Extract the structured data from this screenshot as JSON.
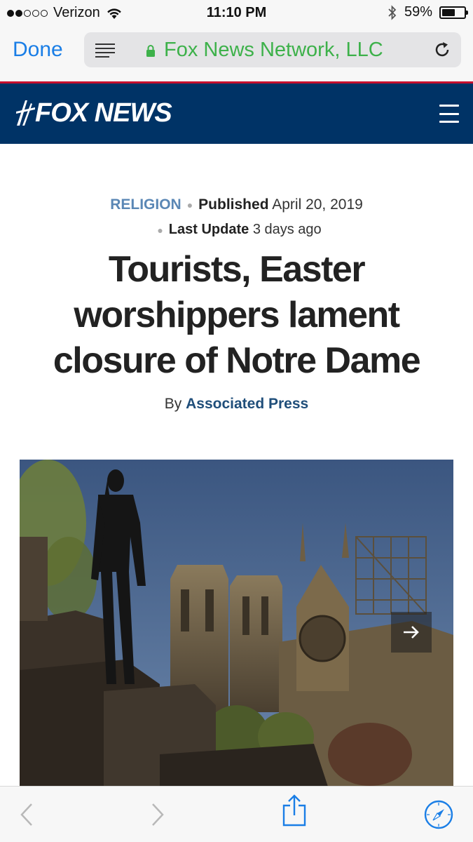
{
  "status_bar": {
    "carrier": "Verizon",
    "time": "11:10 PM",
    "battery_percent": "59%",
    "battery_level": 0.59,
    "signal_bars_filled": 2,
    "signal_bars_total": 5
  },
  "browser": {
    "done_label": "Done",
    "site_name": "Fox News Network, LLC",
    "secure": true
  },
  "header": {
    "logo_text": "FOX NEWS",
    "brand_color": "#003366",
    "accent_color": "#c8102e"
  },
  "article": {
    "category": "RELIGION",
    "published_label": "Published",
    "published_date": "April 20, 2019",
    "updated_label": "Last Update",
    "updated_value": "3 days ago",
    "headline": "Tourists, Easter worshippers lament closure of Notre Dame",
    "byline_prefix": "By",
    "author": "Associated Press"
  },
  "icons": {
    "reader": "reader-view-icon",
    "lock": "lock-icon",
    "reload": "reload-icon",
    "menu": "hamburger-menu-icon",
    "next": "arrow-right-icon",
    "back": "chevron-left-icon",
    "forward": "chevron-right-icon",
    "share": "share-icon",
    "safari": "compass-icon"
  }
}
